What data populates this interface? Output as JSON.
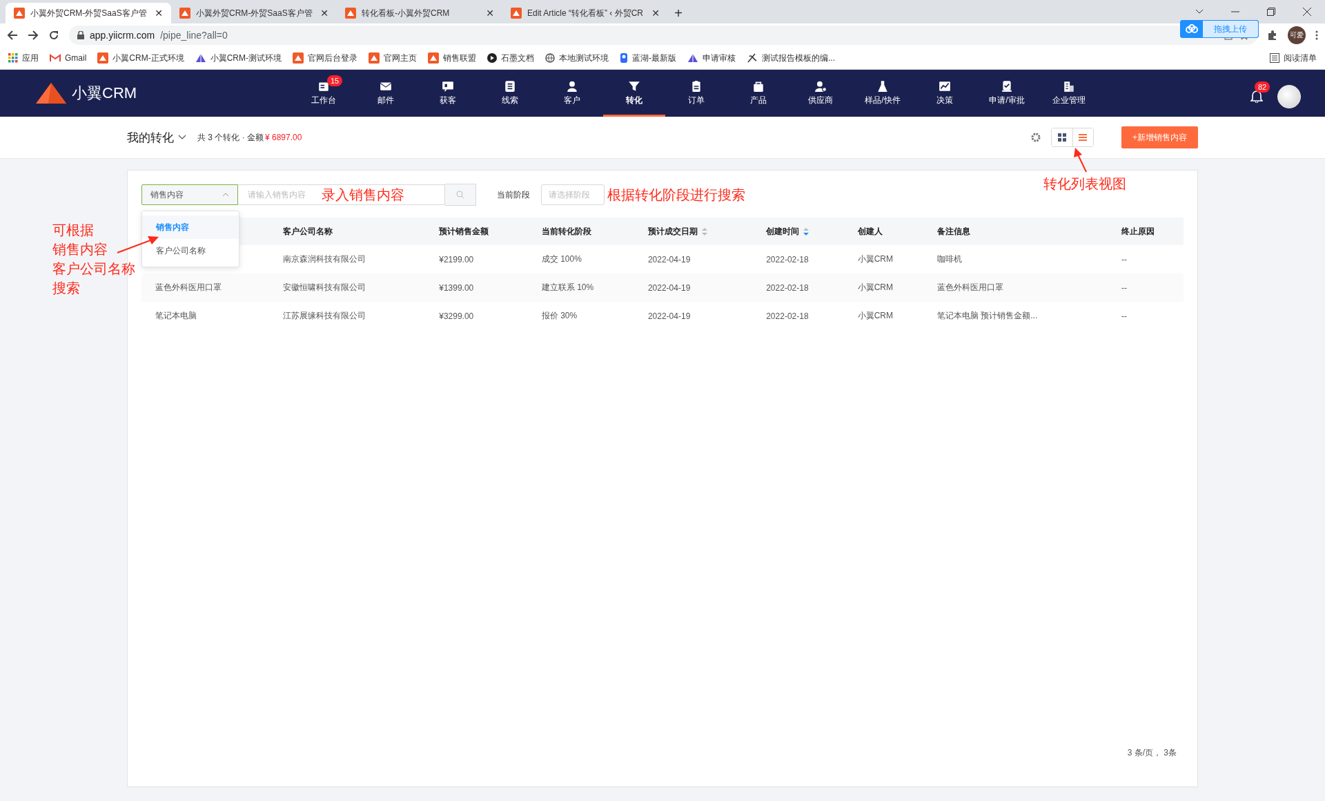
{
  "browser": {
    "tabs": [
      {
        "title": "小翼外贸CRM-外贸SaaS客户管",
        "close": "✕",
        "selected": true
      },
      {
        "title": "小翼外贸CRM-外贸SaaS客户管",
        "close": "✕",
        "selected": false
      },
      {
        "title": "转化看板-小翼外贸CRM",
        "close": "✕",
        "selected": false
      },
      {
        "title": "Edit Article “转化看板” ‹ 外贸CR",
        "close": "✕",
        "selected": false
      }
    ],
    "new_tab": "+",
    "url_host": "app.yiicrm.com",
    "url_path": "/pipe_line?all=0",
    "upload_widget": "拖拽上传",
    "profile": "可爱",
    "bookmarks": [
      {
        "label": "应用",
        "kind": "apps"
      },
      {
        "label": "Gmail",
        "kind": "gmail"
      },
      {
        "label": "小翼CRM-正式环境",
        "kind": "crm"
      },
      {
        "label": "小翼CRM-测试环境",
        "kind": "triangle"
      },
      {
        "label": "官网后台登录",
        "kind": "crm"
      },
      {
        "label": "官网主页",
        "kind": "crm"
      },
      {
        "label": "销售联盟",
        "kind": "crm"
      },
      {
        "label": "石墨文档",
        "kind": "circle"
      },
      {
        "label": "本地测试环境",
        "kind": "globe"
      },
      {
        "label": "蓝湖-最新版",
        "kind": "lake"
      },
      {
        "label": "申请审核",
        "kind": "triangle"
      },
      {
        "label": "测试报告模板的编...",
        "kind": "pen"
      }
    ],
    "reading_list": "阅读清单"
  },
  "app": {
    "logo": "小翼CRM",
    "nav": [
      {
        "label": "工作台",
        "badge": "15",
        "selected": false
      },
      {
        "label": "邮件",
        "selected": false
      },
      {
        "label": "获客",
        "selected": false
      },
      {
        "label": "线索",
        "selected": false
      },
      {
        "label": "客户",
        "selected": false
      },
      {
        "label": "转化",
        "selected": true
      },
      {
        "label": "订单",
        "selected": false
      },
      {
        "label": "产品",
        "selected": false
      },
      {
        "label": "供应商",
        "selected": false
      },
      {
        "label": "样品/快件",
        "selected": false
      },
      {
        "label": "决策",
        "selected": false
      },
      {
        "label": "申请/审批",
        "selected": false
      },
      {
        "label": "企业管理",
        "selected": false
      }
    ],
    "notification_badge": "82"
  },
  "toolbar": {
    "title": "我的转化",
    "summary": "共 3 个转化 · 金额",
    "amount": "¥ 6897.00",
    "views": [
      {
        "kind": "grid",
        "selected": false
      },
      {
        "kind": "list",
        "selected": true
      }
    ],
    "add_button": "+新增销售内容"
  },
  "filters": {
    "field_select": "销售内容",
    "expanded": true,
    "search_placeholder": "请输入销售内容",
    "stage_label": "当前阶段",
    "stage_placeholder": "请选择阶段",
    "options": [
      {
        "label": "销售内容",
        "selected": true
      },
      {
        "label": "客户公司名称",
        "selected": false
      }
    ]
  },
  "table": {
    "columns": [
      {
        "label": "客户公司名称",
        "kind": "plain"
      },
      {
        "label": "预计销售金额",
        "kind": "plain"
      },
      {
        "label": "当前转化阶段",
        "kind": "plain"
      },
      {
        "label": "预计成交日期",
        "kind": "sortable",
        "sorted": false
      },
      {
        "label": "创建时间",
        "kind": "sortable",
        "sorted": true
      },
      {
        "label": "创建人",
        "kind": "plain"
      },
      {
        "label": "备注信息",
        "kind": "plain"
      },
      {
        "label": "终止原因",
        "kind": "plain"
      }
    ],
    "rows": [
      {
        "cells": [
          "南京森润科技有限公司",
          "¥2199.00",
          "成交 100%",
          "2022-04-19",
          "2022-02-18",
          "小翼CRM",
          "咖啡机",
          "--"
        ]
      },
      {
        "product": "蓝色外科医用口罩",
        "cells": [
          "安徽恒啸科技有限公司",
          "¥1399.00",
          "建立联系 10%",
          "2022-04-19",
          "2022-02-18",
          "小翼CRM",
          "蓝色外科医用口罩",
          "--"
        ]
      },
      {
        "product": "笔记本电脑",
        "cells": [
          "江苏展缘科技有限公司",
          "¥3299.00",
          "报价 30%",
          "2022-04-19",
          "2022-02-18",
          "小翼CRM",
          "笔记本电脑 预计销售金额...",
          "--"
        ]
      }
    ],
    "pagination": "3 条/页， 3条"
  },
  "annotations": [
    {
      "lines": [
        "可根据",
        "销售内容",
        "客户公司名称",
        "搜索"
      ],
      "kind": "left"
    },
    {
      "lines": [
        "录入销售内容"
      ],
      "kind": "search"
    },
    {
      "lines": [
        "根据转化阶段进行搜索"
      ],
      "kind": "stage"
    },
    {
      "lines": [
        "转化列表视图"
      ],
      "kind": "view"
    }
  ]
}
